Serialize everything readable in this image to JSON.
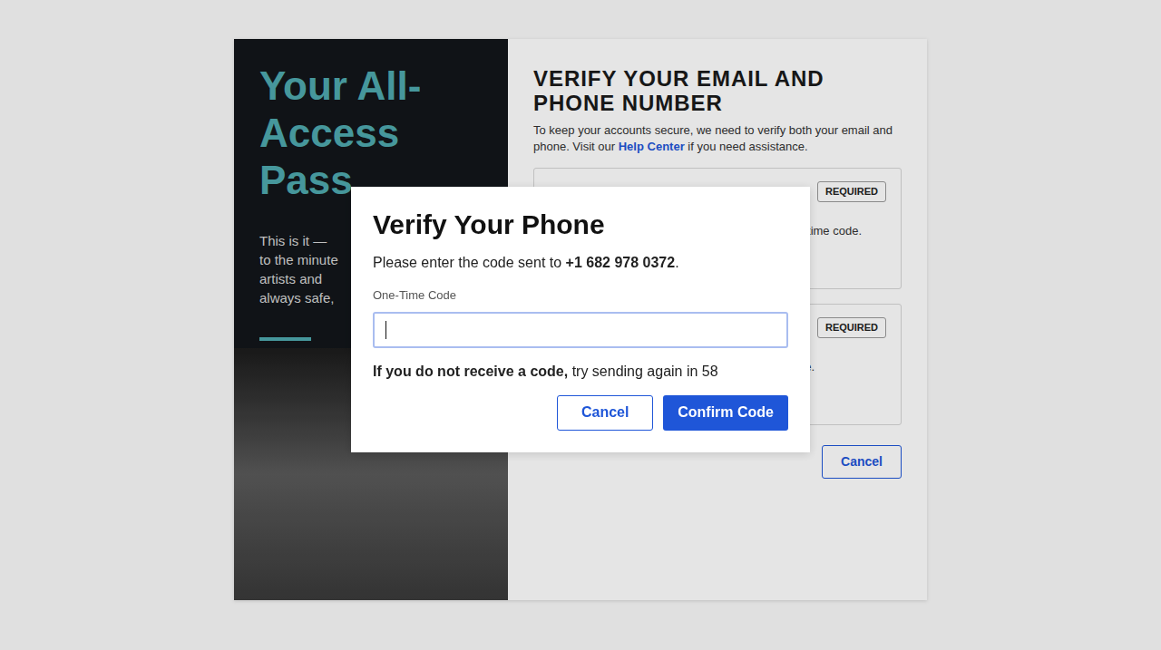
{
  "left_panel": {
    "title": "Your All-Access Pass",
    "lines": [
      "This is it —",
      "to the minute",
      "artists and",
      "always safe,"
    ]
  },
  "main": {
    "heading": "VERIFY YOUR EMAIL AND PHONE NUMBER",
    "description": "To keep your accounts secure, we need to verify both your email and phone. Visit our",
    "help_link": "Help Center",
    "description_end": "if you need assistance.",
    "cards": [
      {
        "badge": "REQUIRED",
        "text": "time code."
      },
      {
        "badge": "REQUIRED",
        "text": "e."
      }
    ],
    "cancel": "Cancel"
  },
  "dialog": {
    "title": "Verify Your Phone",
    "prompt": "Please enter the code sent to",
    "phone": "+1 682 978 0372",
    "prompt_end": ".",
    "field_label": "One-Time Code",
    "field_value": "",
    "focused": true,
    "resend_bold": "If you do not receive a code,",
    "resend_text": "try sending again in 58",
    "buttons": [
      {
        "label": "Cancel",
        "kind": "secondary"
      },
      {
        "label": "Confirm Code",
        "kind": "primary"
      }
    ]
  }
}
